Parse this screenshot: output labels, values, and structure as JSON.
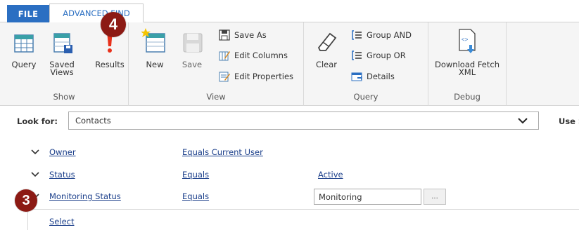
{
  "tabs": [
    {
      "label": "FILE"
    },
    {
      "label": "ADVANCED FIND"
    }
  ],
  "ribbon": {
    "show": {
      "group_label": "Show",
      "query": "Query",
      "saved_views": "Saved\nViews",
      "results": "Results"
    },
    "view": {
      "group_label": "View",
      "new": "New",
      "save": "Save",
      "save_as": "Save As",
      "edit_columns": "Edit Columns",
      "edit_properties": "Edit Properties"
    },
    "query": {
      "group_label": "Query",
      "clear": "Clear",
      "group_and": "Group AND",
      "group_or": "Group OR",
      "details": "Details"
    },
    "debug": {
      "group_label": "Debug",
      "download_fetch_xml": "Download Fetch\nXML"
    }
  },
  "lookfor": {
    "label": "Look for:",
    "value": "Contacts",
    "use_label": "Use S"
  },
  "criteria": [
    {
      "field": "Owner",
      "operator": "Equals Current User",
      "value": ""
    },
    {
      "field": "Status",
      "operator": "Equals",
      "value": "Active"
    },
    {
      "field": "Monitoring Status",
      "operator": "Equals",
      "value": "Monitoring",
      "lookup_button": "..."
    }
  ],
  "select_link": "Select",
  "badges": {
    "step_results": "4",
    "step_row": "3"
  },
  "colors": {
    "brand_blue": "#2b6fc2",
    "link": "#1a3e8a",
    "badge": "#8c1a14",
    "results_red": "#e8311b"
  }
}
